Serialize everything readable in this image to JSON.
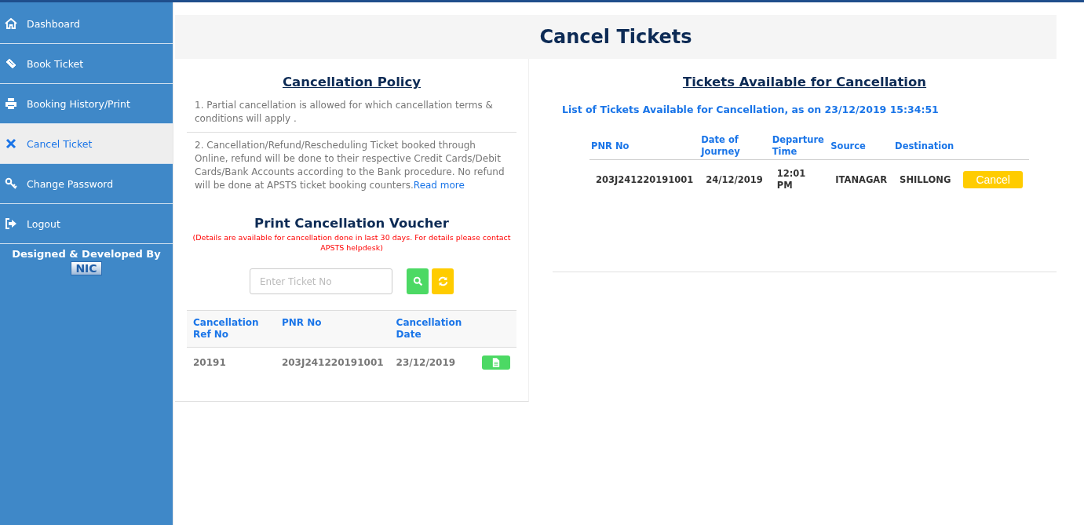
{
  "sidebar": {
    "items": [
      {
        "label": "Dashboard",
        "kind": "home",
        "selected": false
      },
      {
        "label": "Book Ticket",
        "kind": "ticket",
        "selected": false
      },
      {
        "label": "Booking History/Print",
        "kind": "print",
        "selected": false
      },
      {
        "label": "Cancel Ticket",
        "kind": "close",
        "selected": true
      },
      {
        "label": "Change Password",
        "kind": "key",
        "selected": false
      },
      {
        "label": "Logout",
        "kind": "logout",
        "selected": false
      }
    ],
    "credit": "Designed & Developed By",
    "logo": "NIC"
  },
  "page_title": "Cancel Tickets",
  "policy": {
    "title": "Cancellation Policy",
    "items": [
      {
        "text": "1. Partial cancellation is allowed for which cancellation terms & conditions will apply ."
      },
      {
        "text": "2. Cancellation/Refund/Rescheduling Ticket booked through Online, refund will be done to their respective Credit Cards/Debit Cards/Bank Accounts according to the Bank procedure. No refund will be done at APSTS ticket booking counters.",
        "link": "Read more"
      }
    ]
  },
  "voucher": {
    "title": "Print Cancellation Voucher",
    "note": "(Details are available for cancellation done in last 30 days. For details please contact APSTS helpdesk)",
    "search": {
      "placeholder": "Enter Ticket No"
    },
    "table": {
      "columns": [
        "Cancellation Ref No",
        "PNR No",
        "Cancellation Date"
      ],
      "rows": [
        {
          "cells": [
            "20191",
            "203J241220191001",
            "23/12/2019"
          ]
        }
      ]
    }
  },
  "tickets": {
    "title": "Tickets Available for Cancellation",
    "subtitle": "List of Tickets Available for Cancellation, as on 23/12/2019 15:34:51",
    "columns": [
      "PNR No",
      "Date of Journey",
      "Departure Time",
      "Source",
      "Destination"
    ],
    "rows": [
      {
        "cells": [
          "203J241220191001",
          "24/12/2019",
          "12:01 PM",
          "ITANAGAR",
          "SHILLONG"
        ],
        "action": "Cancel"
      }
    ]
  }
}
